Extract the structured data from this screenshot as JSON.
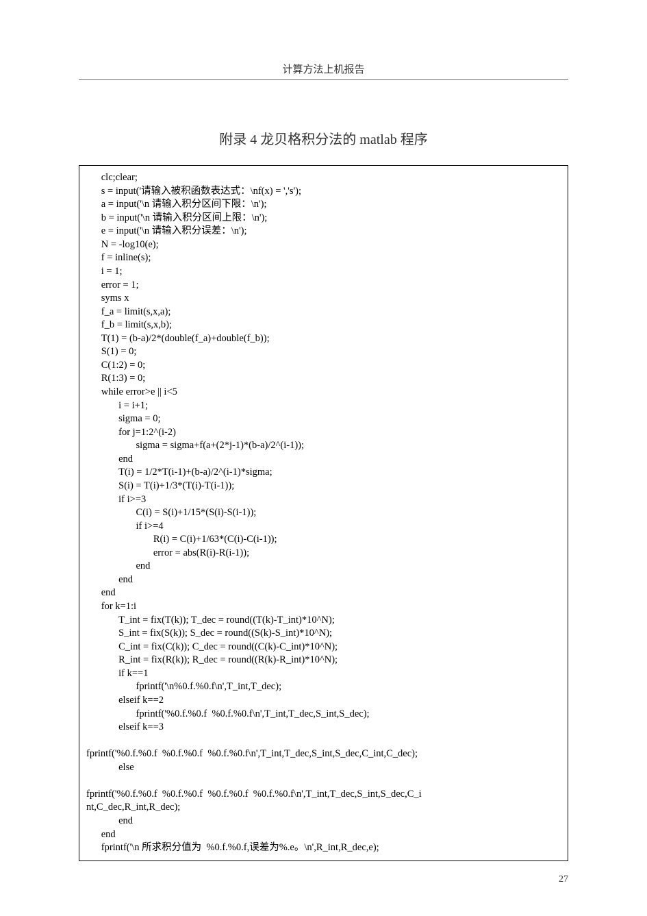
{
  "header": {
    "title": "计算方法上机报告"
  },
  "appendix": {
    "title": "附录 4 龙贝格积分法的 matlab 程序"
  },
  "code": {
    "lines": [
      "      clc;clear;",
      "      s = input('请输入被积函数表达式：\\nf(x) = ','s');",
      "      a = input('\\n 请输入积分区间下限：\\n');",
      "      b = input('\\n 请输入积分区间上限：\\n');",
      "      e = input('\\n 请输入积分误差：\\n');",
      "      N = -log10(e);",
      "      f = inline(s);",
      "      i = 1;",
      "      error = 1;",
      "      syms x",
      "      f_a = limit(s,x,a);",
      "      f_b = limit(s,x,b);",
      "      T(1) = (b-a)/2*(double(f_a)+double(f_b));",
      "      S(1) = 0;",
      "      C(1:2) = 0;",
      "      R(1:3) = 0;",
      "      while error>e || i<5",
      "             i = i+1;",
      "             sigma = 0;",
      "             for j=1:2^(i-2)",
      "                    sigma = sigma+f(a+(2*j-1)*(b-a)/2^(i-1));",
      "             end",
      "             T(i) = 1/2*T(i-1)+(b-a)/2^(i-1)*sigma;",
      "             S(i) = T(i)+1/3*(T(i)-T(i-1));",
      "             if i>=3",
      "                    C(i) = S(i)+1/15*(S(i)-S(i-1));",
      "                    if i>=4",
      "                           R(i) = C(i)+1/63*(C(i)-C(i-1));",
      "                           error = abs(R(i)-R(i-1));",
      "                    end",
      "             end",
      "      end",
      "      for k=1:i",
      "             T_int = fix(T(k)); T_dec = round((T(k)-T_int)*10^N);",
      "             S_int = fix(S(k)); S_dec = round((S(k)-S_int)*10^N);",
      "             C_int = fix(C(k)); C_dec = round((C(k)-C_int)*10^N);",
      "             R_int = fix(R(k)); R_dec = round((R(k)-R_int)*10^N);",
      "             if k==1",
      "                    fprintf('\\n%0.f.%0.f\\n',T_int,T_dec);",
      "             elseif k==2",
      "                    fprintf('%0.f.%0.f  %0.f.%0.f\\n',T_int,T_dec,S_int,S_dec);",
      "             elseif k==3",
      "",
      "fprintf('%0.f.%0.f  %0.f.%0.f  %0.f.%0.f\\n',T_int,T_dec,S_int,S_dec,C_int,C_dec);",
      "             else",
      "",
      "fprintf('%0.f.%0.f  %0.f.%0.f  %0.f.%0.f  %0.f.%0.f\\n',T_int,T_dec,S_int,S_dec,C_i",
      "nt,C_dec,R_int,R_dec);",
      "             end",
      "      end",
      "      fprintf('\\n 所求积分值为  %0.f.%0.f,误差为%.e。\\n',R_int,R_dec,e);"
    ]
  },
  "page": {
    "number": "27"
  }
}
